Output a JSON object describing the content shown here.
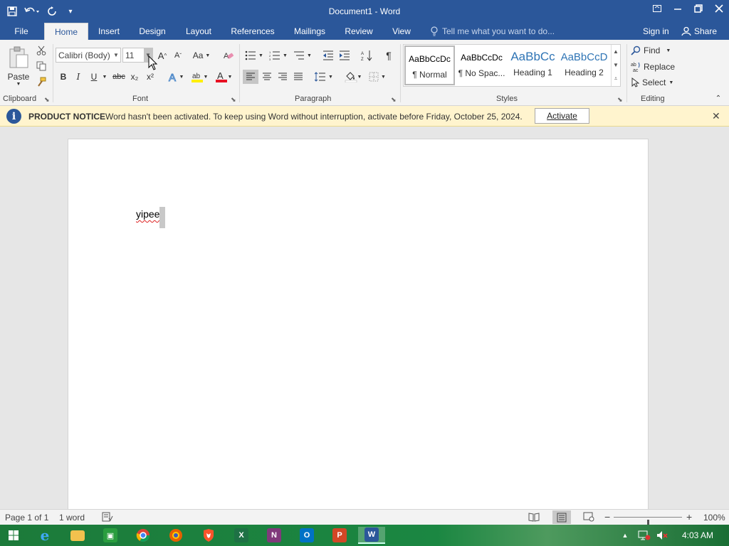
{
  "window": {
    "title": "Document1 - Word",
    "qat": {
      "save": "save-icon",
      "undo": "undo-icon",
      "redo": "repeat-icon",
      "customize": "▾"
    }
  },
  "tabs": [
    "File",
    "Home",
    "Insert",
    "Design",
    "Layout",
    "References",
    "Mailings",
    "Review",
    "View"
  ],
  "active_tab": "Home",
  "tell_me_placeholder": "Tell me what you want to do...",
  "sign_in": "Sign in",
  "share": "Share",
  "ribbon": {
    "clipboard": {
      "label": "Clipboard",
      "paste": "Paste"
    },
    "font": {
      "label": "Font",
      "font_name": "Calibri (Body)",
      "font_size": "11",
      "case_label": "Aa",
      "bold": "B",
      "italic": "I",
      "underline": "U",
      "strike": "abc",
      "subscript": "x₂",
      "superscript": "x²"
    },
    "paragraph": {
      "label": "Paragraph"
    },
    "styles": {
      "label": "Styles",
      "items": [
        {
          "sample": "AaBbCcDc",
          "name": "¶ Normal"
        },
        {
          "sample": "AaBbCcDc",
          "name": "¶ No Spac..."
        },
        {
          "sample": "AaBbCc",
          "name": "Heading 1"
        },
        {
          "sample": "AaBbCcD",
          "name": "Heading 2"
        }
      ]
    },
    "editing": {
      "label": "Editing",
      "find": "Find",
      "replace": "Replace",
      "select": "Select"
    }
  },
  "notice": {
    "title": "PRODUCT NOTICE",
    "message": "Word hasn't been activated. To keep using Word without interruption, activate before Friday, October 25, 2024.",
    "button": "Activate"
  },
  "document": {
    "text": "yipee"
  },
  "status": {
    "page": "Page 1 of 1",
    "words": "1 word",
    "zoom": "100%",
    "zoom_level": 1.0
  },
  "taskbar": {
    "time": "4:03 AM"
  }
}
